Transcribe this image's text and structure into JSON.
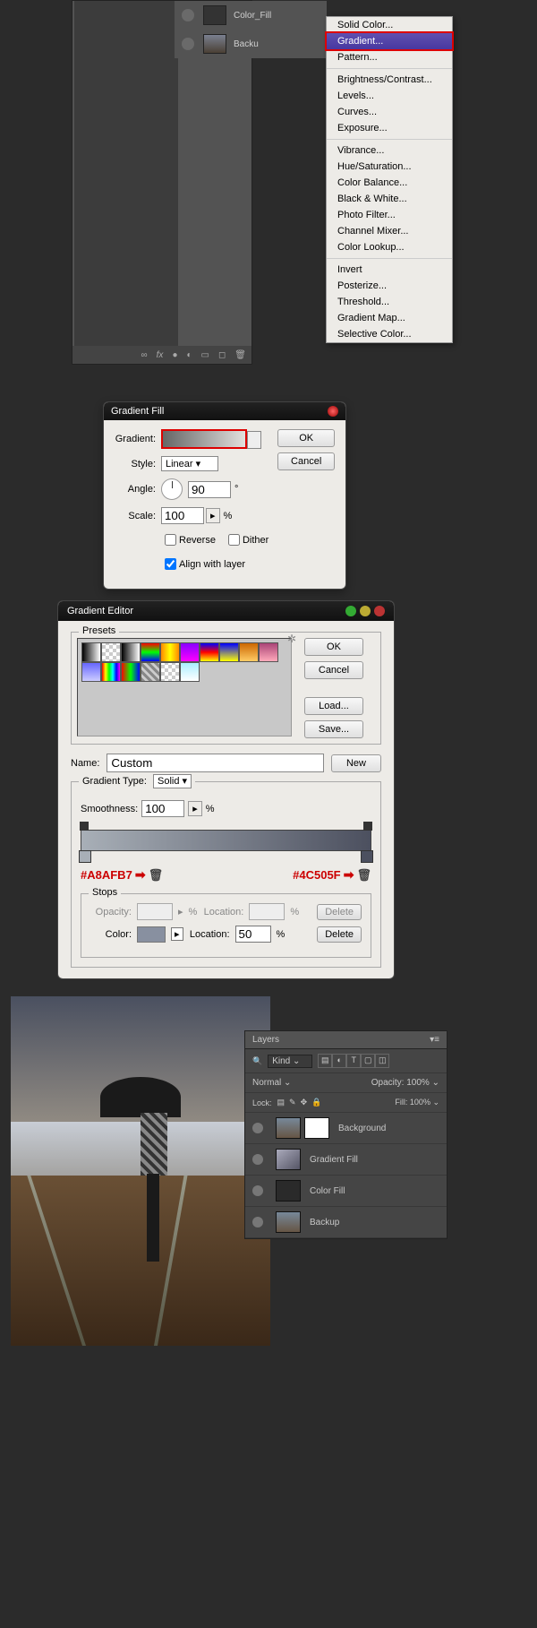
{
  "layer_panel_top": {
    "layers": [
      {
        "name": "Color_Fill"
      },
      {
        "name": "Backu"
      }
    ],
    "bottom_icons": [
      "∞",
      "fx",
      "●",
      "◐",
      "▣",
      "◻",
      "▭",
      "🗑"
    ]
  },
  "menu": {
    "items": [
      "Solid Color...",
      "Gradient...",
      "Pattern...",
      "",
      "Brightness/Contrast...",
      "Levels...",
      "Curves...",
      "Exposure...",
      "",
      "Vibrance...",
      "Hue/Saturation...",
      "Color Balance...",
      "Black & White...",
      "Photo Filter...",
      "Channel Mixer...",
      "Color Lookup...",
      "",
      "Invert",
      "Posterize...",
      "Threshold...",
      "Gradient Map...",
      "Selective Color..."
    ],
    "highlighted": "Gradient..."
  },
  "gradient_fill": {
    "title": "Gradient Fill",
    "ok": "OK",
    "cancel": "Cancel",
    "gradient_label": "Gradient:",
    "style_label": "Style:",
    "style_value": "Linear",
    "angle_label": "Angle:",
    "angle_value": "90",
    "angle_deg": "°",
    "scale_label": "Scale:",
    "scale_value": "100",
    "scale_pct": "%",
    "reverse": "Reverse",
    "dither": "Dither",
    "align": "Align with layer"
  },
  "gradient_editor": {
    "title": "Gradient Editor",
    "presets": "Presets",
    "ok": "OK",
    "cancel": "Cancel",
    "load": "Load...",
    "save": "Save...",
    "name_label": "Name:",
    "name_value": "Custom",
    "new": "New",
    "type_label": "Gradient Type:",
    "type_value": "Solid",
    "smooth_label": "Smoothness:",
    "smooth_value": "100",
    "pct": "%",
    "hex_left": "#A8AFB7",
    "hex_right": "#4C505F",
    "stops": "Stops",
    "opacity": "Opacity:",
    "location": "Location:",
    "color": "Color:",
    "loc_value": "50",
    "delete": "Delete",
    "swatch_colors": [
      "linear-gradient(to right,#000,#fff)",
      "repeating-conic-gradient(#ccc 0 25%,#fff 0 50%) 0/8px 8px",
      "linear-gradient(to right,#000,#fff)",
      "linear-gradient(#f00,#0f0,#00f)",
      "linear-gradient(to right,#f80,#ff0,#f80)",
      "linear-gradient(#80f,#f0f)",
      "linear-gradient(#00f,#f00,#ff0)",
      "linear-gradient(#00f,#ff0)",
      "linear-gradient(#c60,#fc6)",
      "linear-gradient(#a47,#fab)",
      "linear-gradient(#66f,#ccf)",
      "linear-gradient(to right,#f00,#ff0,#0f0,#0ff,#00f,#f0f)",
      "linear-gradient(to right,#f00,#0f0,#00f)",
      "repeating-linear-gradient(45deg,#888,#888 3px,#ccc 3px,#ccc 6px)",
      "repeating-conic-gradient(#ccc 0 25%,#fff 0 50%) 0/8px 8px",
      "linear-gradient(#aef,#fff)"
    ]
  },
  "layers_panel": {
    "tab": "Layers",
    "kind": "Kind",
    "filter_icons": [
      "▤",
      "◐",
      "T",
      "▢",
      "◫"
    ],
    "blend": "Normal",
    "opacity_label": "Opacity:",
    "opacity_value": "100%",
    "lock_label": "Lock:",
    "lock_icons": [
      "▤",
      "✎",
      "✥",
      "🔒"
    ],
    "fill_label": "Fill:",
    "fill_value": "100%",
    "layers": [
      {
        "name": "Background",
        "has_mask": true,
        "thumb": "img2"
      },
      {
        "name": "Gradient Fill",
        "has_mask": false,
        "thumb": "grad"
      },
      {
        "name": "Color Fill",
        "has_mask": false,
        "thumb": "dark2"
      },
      {
        "name": "Backup",
        "has_mask": false,
        "thumb": "img2"
      }
    ]
  }
}
